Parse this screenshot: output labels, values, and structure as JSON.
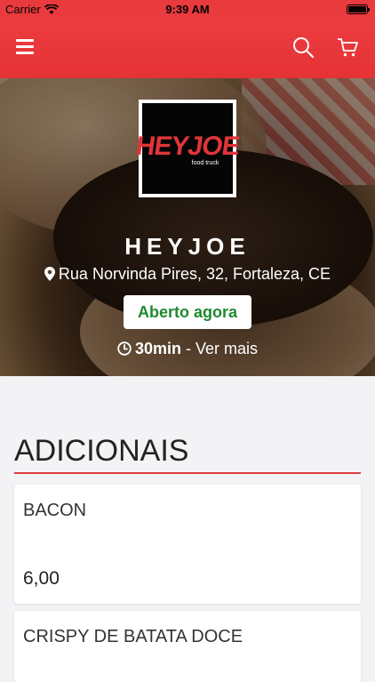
{
  "status_bar": {
    "carrier": "Carrier",
    "time": "9:39 AM"
  },
  "nav": {
    "menu_icon": "hamburger-icon",
    "search_icon": "search-icon",
    "cart_icon": "cart-icon",
    "bg_color": "#e93a3e"
  },
  "store": {
    "logo_text": "HEYJOE",
    "logo_sub": "food truck",
    "name": "HEYJOE",
    "address": "Rua Norvinda Pires, 32, Fortaleza, CE",
    "status": "Aberto agora",
    "delivery_time": "30min",
    "delivery_link": " - Ver mais",
    "status_color": "#1e8a2e"
  },
  "section": {
    "title": "ADICIONAIS",
    "accent": "#e03a3c"
  },
  "items": [
    {
      "name": "BACON",
      "price": "6,00"
    },
    {
      "name": "CRISPY DE BATATA DOCE",
      "price": ""
    }
  ]
}
